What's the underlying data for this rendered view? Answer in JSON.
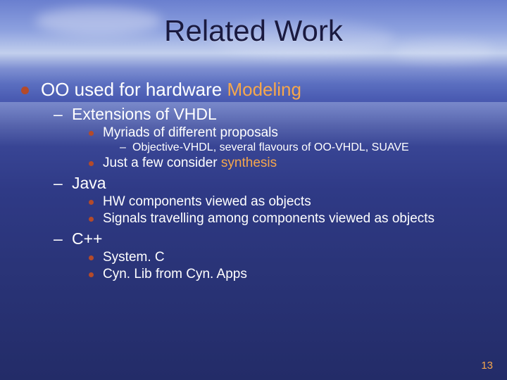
{
  "title": "Related Work",
  "lvl1": {
    "text_before": "OO used for hardware ",
    "accent": "Modeling"
  },
  "sec1": {
    "heading": "Extensions of VHDL",
    "b1": "Myriads of different proposals",
    "b1_sub": "Objective-VHDL, several flavours of OO-VHDL, SUAVE",
    "b2_before": "Just a few consider ",
    "b2_accent": "synthesis"
  },
  "sec2": {
    "heading": "Java",
    "b1": "HW components viewed as objects",
    "b2": "Signals travelling among components viewed as objects"
  },
  "sec3": {
    "heading": "C++",
    "b1": "System. C",
    "b2": "Cyn. Lib from Cyn. Apps"
  },
  "page_number": "13"
}
